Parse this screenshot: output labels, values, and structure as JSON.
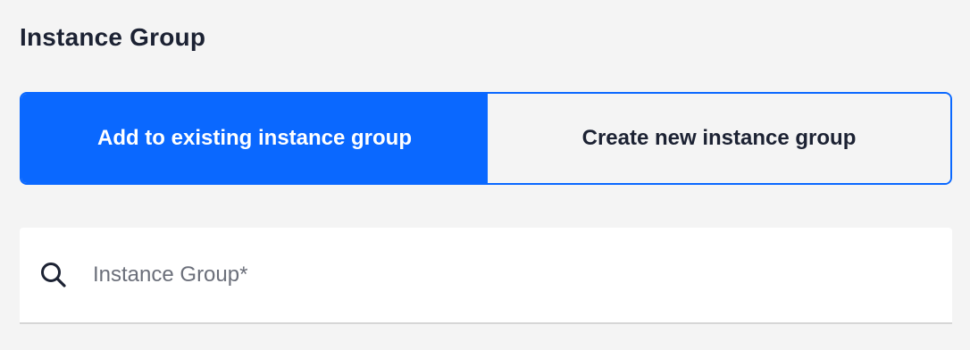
{
  "section": {
    "title": "Instance Group"
  },
  "toggle": {
    "options": [
      {
        "label": "Add to existing instance group",
        "selected": true
      },
      {
        "label": "Create new instance group",
        "selected": false
      }
    ]
  },
  "search": {
    "icon": "search-icon",
    "placeholder": "Instance Group*",
    "value": ""
  },
  "colors": {
    "accent": "#0a68ff",
    "text": "#1c2233",
    "background": "#f4f4f4"
  }
}
